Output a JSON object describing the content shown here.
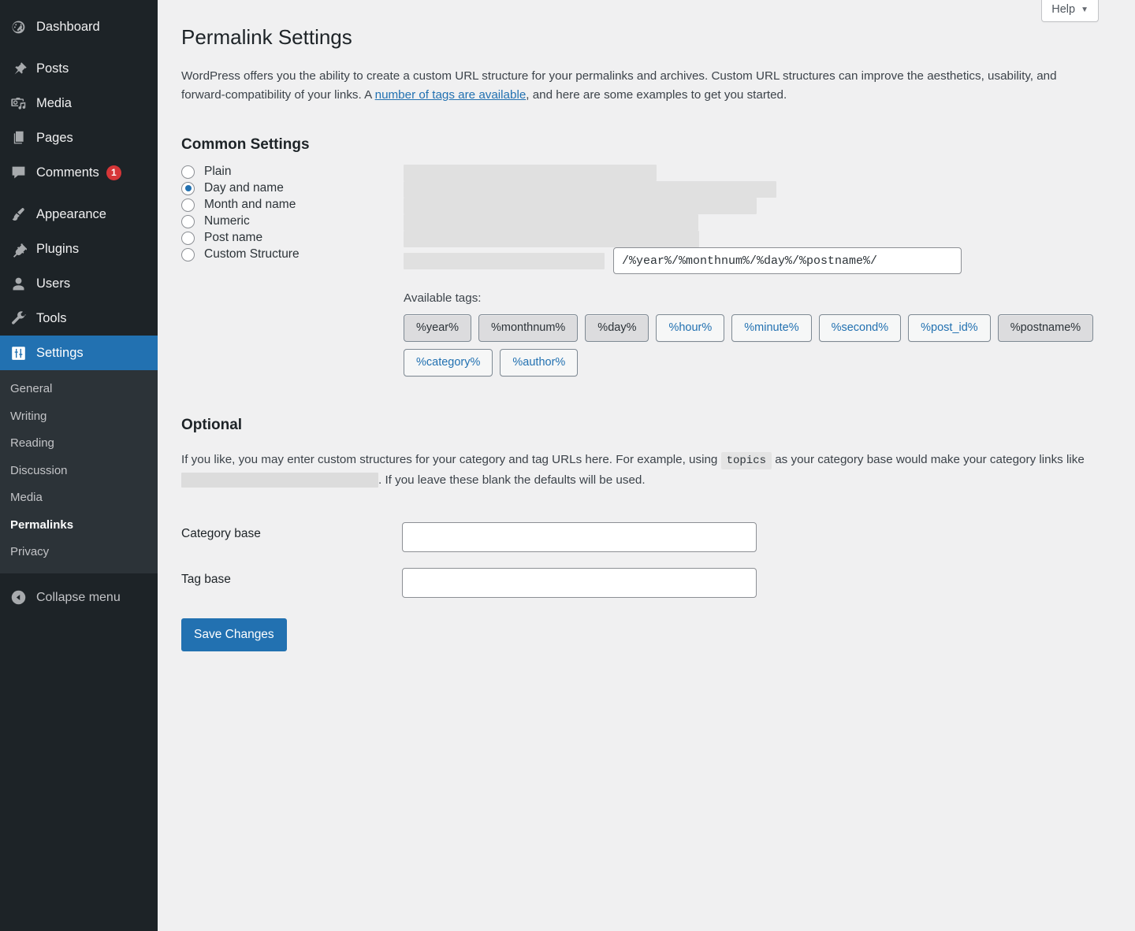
{
  "colors": {
    "sidebar_bg": "#1d2327",
    "submenu_bg": "#2c3338",
    "accent": "#2271b1",
    "badge": "#d63638",
    "page_bg": "#f0f0f1",
    "redaction": "#e0e0e0"
  },
  "sidebar": {
    "items": [
      {
        "label": "Dashboard",
        "icon": "dashboard-icon",
        "badge": null,
        "active": false
      },
      {
        "label": "Posts",
        "icon": "pin-icon",
        "badge": null,
        "active": false
      },
      {
        "label": "Media",
        "icon": "media-icon",
        "badge": null,
        "active": false
      },
      {
        "label": "Pages",
        "icon": "pages-icon",
        "badge": null,
        "active": false
      },
      {
        "label": "Comments",
        "icon": "comment-icon",
        "badge": "1",
        "active": false
      },
      {
        "label": "Appearance",
        "icon": "brush-icon",
        "badge": null,
        "active": false
      },
      {
        "label": "Plugins",
        "icon": "plug-icon",
        "badge": null,
        "active": false
      },
      {
        "label": "Users",
        "icon": "user-icon",
        "badge": null,
        "active": false
      },
      {
        "label": "Tools",
        "icon": "wrench-icon",
        "badge": null,
        "active": false
      },
      {
        "label": "Settings",
        "icon": "sliders-icon",
        "badge": null,
        "active": true
      }
    ],
    "submenu": [
      {
        "label": "General",
        "current": false
      },
      {
        "label": "Writing",
        "current": false
      },
      {
        "label": "Reading",
        "current": false
      },
      {
        "label": "Discussion",
        "current": false
      },
      {
        "label": "Media",
        "current": false
      },
      {
        "label": "Permalinks",
        "current": true
      },
      {
        "label": "Privacy",
        "current": false
      }
    ],
    "collapse_label": "Collapse menu",
    "collapse_icon": "chevron-left-circle-icon"
  },
  "header": {
    "help_label": "Help",
    "help_caret": "▼",
    "page_title": "Permalink Settings"
  },
  "intro": {
    "part1": "WordPress offers you the ability to create a custom URL structure for your permalinks and archives. Custom URL structures can improve the aesthetics, usability, and forward-compatibility of your links. A ",
    "link": "number of tags are available",
    "part2": ", and here are some examples to get you started."
  },
  "common_settings": {
    "heading": "Common Settings",
    "options": [
      {
        "label": "Plain",
        "selected": false,
        "redacted_width": 321
      },
      {
        "label": "Day and name",
        "selected": true,
        "redacted_width": 473
      },
      {
        "label": "Month and name",
        "selected": false,
        "redacted_width": 448
      },
      {
        "label": "Numeric",
        "selected": false,
        "redacted_width": 374
      },
      {
        "label": "Post name",
        "selected": false,
        "redacted_width": 375
      }
    ],
    "custom": {
      "label": "Custom Structure",
      "redacted_width": 255,
      "input_value": "/%year%/%monthnum%/%day%/%postname%/",
      "available_tags_label": "Available tags:",
      "tags": [
        {
          "label": "%year%",
          "selected": true
        },
        {
          "label": "%monthnum%",
          "selected": true
        },
        {
          "label": "%day%",
          "selected": true
        },
        {
          "label": "%hour%",
          "selected": false
        },
        {
          "label": "%minute%",
          "selected": false
        },
        {
          "label": "%second%",
          "selected": false
        },
        {
          "label": "%post_id%",
          "selected": false
        },
        {
          "label": "%postname%",
          "selected": true
        },
        {
          "label": "%category%",
          "selected": false
        },
        {
          "label": "%author%",
          "selected": false
        }
      ]
    }
  },
  "optional": {
    "heading": "Optional",
    "text_part1": "If you like, you may enter custom structures for your category and tag URLs here. For example, using ",
    "code": "topics",
    "text_part2": " as your category base would make your category links like ",
    "redacted_width": 250,
    "text_part3": ". If you leave these blank the defaults will be used.",
    "category_base_label": "Category base",
    "category_base_value": "",
    "tag_base_label": "Tag base",
    "tag_base_value": ""
  },
  "footer": {
    "save_label": "Save Changes"
  }
}
